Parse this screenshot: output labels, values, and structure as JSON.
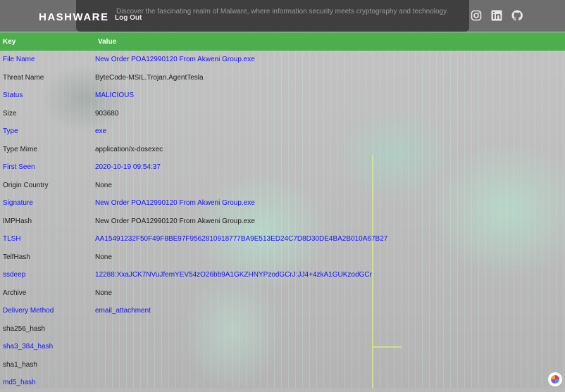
{
  "header": {
    "brand": "HASHWARE",
    "logout_label": "Log Out",
    "tagline": "Discover the fascinating realm of Malware, where information security meets cryptography and technology.",
    "icons": [
      "instagram-icon",
      "linkedin-icon",
      "github-icon"
    ]
  },
  "table": {
    "headers": {
      "key": "Key",
      "value": "Value"
    },
    "rows": [
      {
        "key": "File Name",
        "value": "New Order POA12990120 From Akweni Group.exe",
        "style": "link"
      },
      {
        "key": "Threat Name",
        "value": "ByteCode-MSIL.Trojan.AgentTesla",
        "style": "plain"
      },
      {
        "key": "Status",
        "value": "MALICIOUS",
        "style": "link"
      },
      {
        "key": "Size",
        "value": "903680",
        "style": "plain"
      },
      {
        "key": "Type",
        "value": "exe",
        "style": "link"
      },
      {
        "key": "Type Mime",
        "value": "application/x-dosexec",
        "style": "plain"
      },
      {
        "key": "First Seen",
        "value": "2020-10-19 09:54:37",
        "style": "link"
      },
      {
        "key": "Origin Country",
        "value": "None",
        "style": "plain"
      },
      {
        "key": "Signature",
        "value": "New Order POA12990120 From Akweni Group.exe",
        "style": "link"
      },
      {
        "key": "IMPHash",
        "value": "New Order POA12990120 From Akweni Group.exe",
        "style": "plain"
      },
      {
        "key": "TLSH",
        "value": "AA15491232F50F49F8BE97F9562810918777BA9E513ED24C7D8D30DE4BA2B010A67B27",
        "style": "link"
      },
      {
        "key": "TelfHash",
        "value": "None",
        "style": "plain"
      },
      {
        "key": "ssdeep",
        "value": "12288:XxaJCK7NVuJfemYEV54zO26bb9A1GKZHNYPzodGCrJ:JJ4+4zkA1GUKzodGCr",
        "style": "link"
      },
      {
        "key": "Archive",
        "value": "None",
        "style": "plain"
      },
      {
        "key": "Delivery Method",
        "value": "email_attachment",
        "style": "link"
      },
      {
        "key": "sha256_hash",
        "value": "",
        "style": "plain"
      },
      {
        "key": "sha3_384_hash",
        "value": "",
        "style": "link"
      },
      {
        "key": "sha1_hash",
        "value": "",
        "style": "plain"
      },
      {
        "key": "md5_hash",
        "value": "",
        "style": "link"
      }
    ]
  },
  "colors": {
    "header_bg": "#4cae4c",
    "link_text": "#1414ff",
    "plain_text": "#202020"
  }
}
